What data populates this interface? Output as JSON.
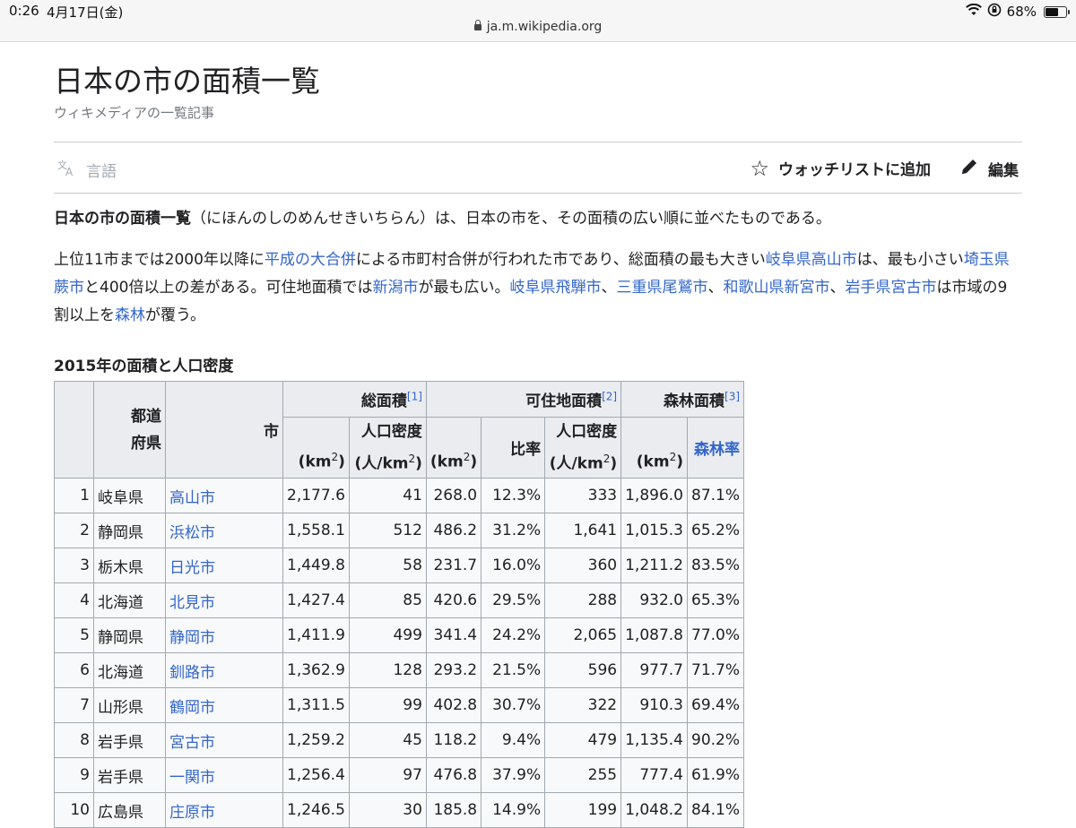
{
  "status_bar": {
    "time": "0:26",
    "date": "4月17日(金)",
    "battery": "68%",
    "battery_level": 0.68,
    "url": "ja.m.wikipedia.org"
  },
  "article": {
    "title": "日本の市の面積一覧",
    "subtitle": "ウィキメディアの一覧記事",
    "language_label": "言語",
    "watch_label": "ウォッチリストに追加",
    "edit_label": "編集"
  },
  "intro": {
    "bold": "日本の市の面積一覧",
    "rest": "（にほんのしのめんせきいちらん）は、日本の市を、その面積の広い順に並べたものである。"
  },
  "para2": {
    "t1": "上位11市までは2000年以降に",
    "l1": "平成の大合併",
    "t2": "による市町村合併が行われた市であり、総面積の最も大きい",
    "l2": "岐阜県高山市",
    "t3": "は、最も小さい",
    "l3": "埼玉県蕨市",
    "t4": "と400倍以上の差がある。可住地面積では",
    "l4": "新潟市",
    "t5": "が最も広い。",
    "l5": "岐阜県飛騨市",
    "t6": "、",
    "l6": "三重県尾鷲市",
    "t7": "、",
    "l7": "和歌山県新宮市",
    "t8": "、",
    "l8": "岩手県宮古市",
    "t9": "は市域の9割以上を",
    "l9": "森林",
    "t10": "が覆う。"
  },
  "table": {
    "caption": "2015年の面積と人口密度",
    "headers": {
      "pref_line1": "都道",
      "pref_line2": "府県",
      "city": "市",
      "total_area": "総面積",
      "total_ref": "[1]",
      "habitable_area": "可住地面積",
      "habitable_ref": "[2]",
      "forest_area": "森林面積",
      "forest_ref": "[3]",
      "km2_prefix": "(km",
      "sq": "2",
      "close": ")",
      "density_line1": "人口密度",
      "density_line2_prefix": "(人/km",
      "ratio": "比率",
      "forest_ratio": "森林率"
    },
    "rows": [
      {
        "rank": "1",
        "pref": "岐阜県",
        "city": "高山市",
        "total": "2,177.6",
        "density": "41",
        "hab": "268.0",
        "ratio": "12.3%",
        "hab_density": "333",
        "forest": "1,896.0",
        "forest_ratio": "87.1%"
      },
      {
        "rank": "2",
        "pref": "静岡県",
        "city": "浜松市",
        "total": "1,558.1",
        "density": "512",
        "hab": "486.2",
        "ratio": "31.2%",
        "hab_density": "1,641",
        "forest": "1,015.3",
        "forest_ratio": "65.2%"
      },
      {
        "rank": "3",
        "pref": "栃木県",
        "city": "日光市",
        "total": "1,449.8",
        "density": "58",
        "hab": "231.7",
        "ratio": "16.0%",
        "hab_density": "360",
        "forest": "1,211.2",
        "forest_ratio": "83.5%"
      },
      {
        "rank": "4",
        "pref": "北海道",
        "city": "北見市",
        "total": "1,427.4",
        "density": "85",
        "hab": "420.6",
        "ratio": "29.5%",
        "hab_density": "288",
        "forest": "932.0",
        "forest_ratio": "65.3%"
      },
      {
        "rank": "5",
        "pref": "静岡県",
        "city": "静岡市",
        "total": "1,411.9",
        "density": "499",
        "hab": "341.4",
        "ratio": "24.2%",
        "hab_density": "2,065",
        "forest": "1,087.8",
        "forest_ratio": "77.0%"
      },
      {
        "rank": "6",
        "pref": "北海道",
        "city": "釧路市",
        "total": "1,362.9",
        "density": "128",
        "hab": "293.2",
        "ratio": "21.5%",
        "hab_density": "596",
        "forest": "977.7",
        "forest_ratio": "71.7%"
      },
      {
        "rank": "7",
        "pref": "山形県",
        "city": "鶴岡市",
        "total": "1,311.5",
        "density": "99",
        "hab": "402.8",
        "ratio": "30.7%",
        "hab_density": "322",
        "forest": "910.3",
        "forest_ratio": "69.4%"
      },
      {
        "rank": "8",
        "pref": "岩手県",
        "city": "宮古市",
        "total": "1,259.2",
        "density": "45",
        "hab": "118.2",
        "ratio": "9.4%",
        "hab_density": "479",
        "forest": "1,135.4",
        "forest_ratio": "90.2%"
      },
      {
        "rank": "9",
        "pref": "岩手県",
        "city": "一関市",
        "total": "1,256.4",
        "density": "97",
        "hab": "476.8",
        "ratio": "37.9%",
        "hab_density": "255",
        "forest": "777.4",
        "forest_ratio": "61.9%"
      },
      {
        "rank": "10",
        "pref": "広島県",
        "city": "庄原市",
        "total": "1,246.5",
        "density": "30",
        "hab": "185.8",
        "ratio": "14.9%",
        "hab_density": "199",
        "forest": "1,048.2",
        "forest_ratio": "84.1%"
      }
    ]
  },
  "colors": {
    "link": "#3366cc",
    "header_bg": "#eaecf0",
    "cell_bg": "#f8f9fa",
    "border": "#a2a9b1"
  }
}
